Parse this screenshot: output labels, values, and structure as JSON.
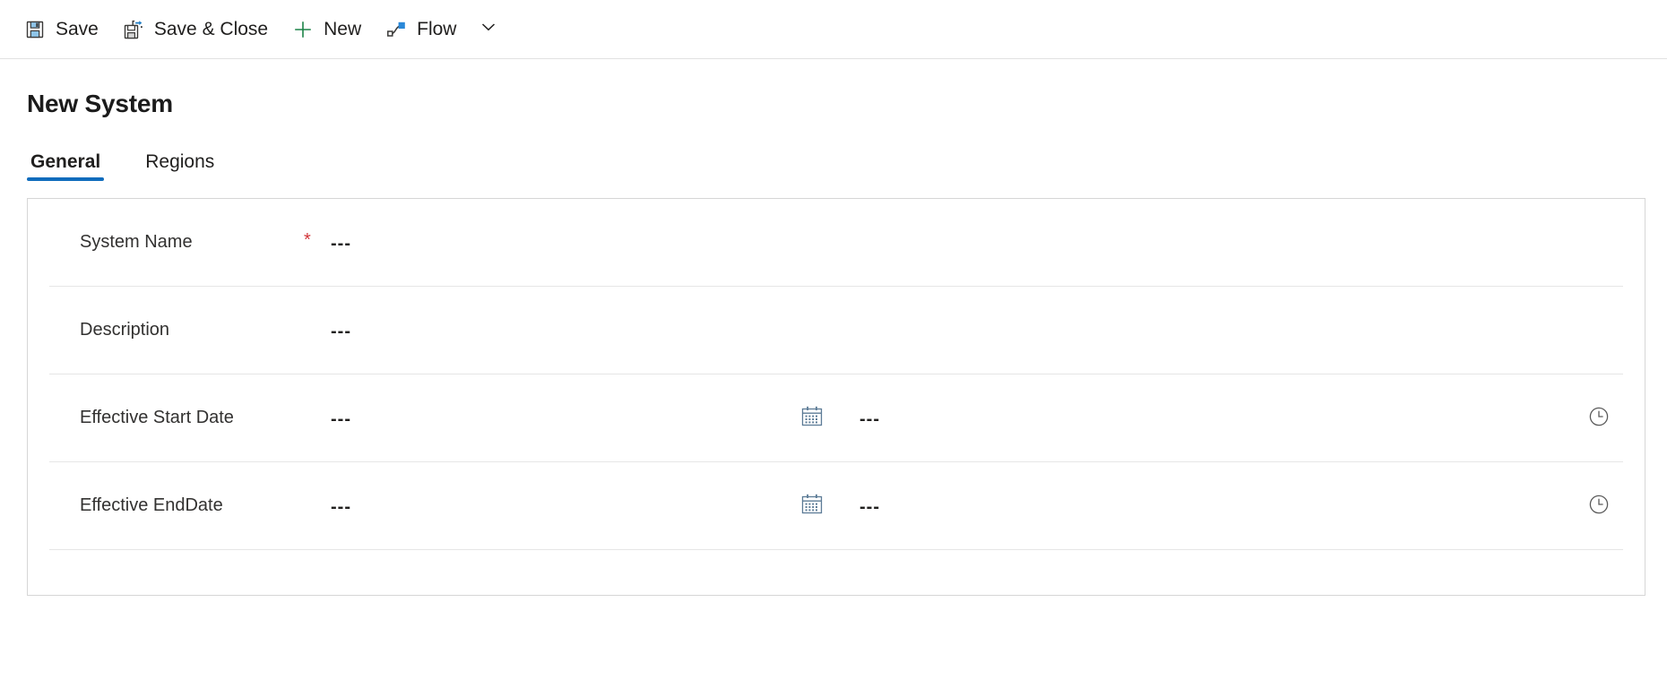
{
  "command_bar": {
    "buttons": [
      {
        "id": "save",
        "label": "Save",
        "icon": "save-icon"
      },
      {
        "id": "save_close",
        "label": "Save & Close",
        "icon": "save-and-close-icon"
      },
      {
        "id": "new",
        "label": "New",
        "icon": "plus-icon"
      },
      {
        "id": "flow",
        "label": "Flow",
        "icon": "flow-icon"
      }
    ],
    "overflow_icon": "chevron-down-icon"
  },
  "page": {
    "title": "New System"
  },
  "tabs": [
    {
      "id": "general",
      "label": "General",
      "active": true
    },
    {
      "id": "regions",
      "label": "Regions",
      "active": false
    }
  ],
  "form": {
    "fields": [
      {
        "id": "system_name",
        "label": "System Name",
        "required": true,
        "required_marker": "*",
        "value": "---",
        "type": "text"
      },
      {
        "id": "description",
        "label": "Description",
        "required": false,
        "required_marker": "",
        "value": "---",
        "type": "text"
      },
      {
        "id": "effective_start_date",
        "label": "Effective Start Date",
        "required": false,
        "required_marker": "",
        "value": "---",
        "time_value": "---",
        "date_icon": "calendar-icon",
        "time_icon": "clock-icon",
        "type": "datetime"
      },
      {
        "id": "effective_end_date",
        "label": "Effective EndDate",
        "required": false,
        "required_marker": "",
        "value": "---",
        "time_value": "---",
        "date_icon": "calendar-icon",
        "time_icon": "clock-icon",
        "type": "datetime"
      }
    ]
  },
  "colors": {
    "accent": "#0f6cbd",
    "required": "#d13438",
    "save_icon_fill": "#8ec4e8",
    "new_icon": "#107c41",
    "flow_icon": "#0f6cbd",
    "text": "#201f1e",
    "border": "#d6d6d6"
  }
}
